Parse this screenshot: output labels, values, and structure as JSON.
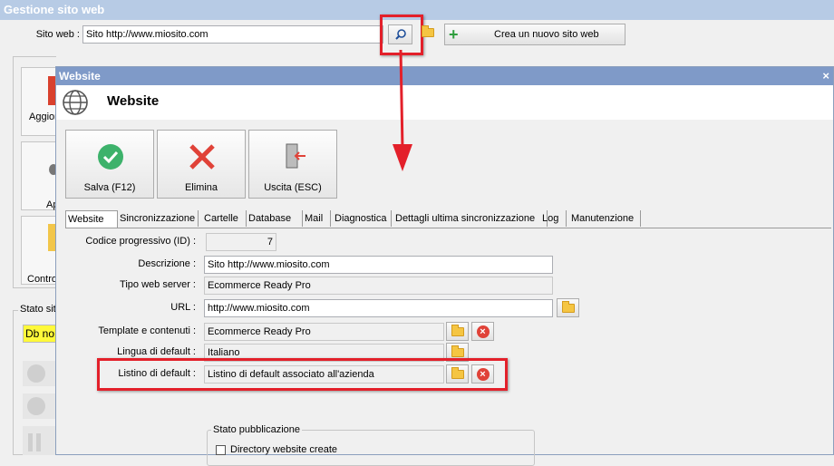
{
  "app_title": "Gestione sito web",
  "sitoweb": {
    "label": "Sito web :",
    "value": "Sito http://www.miosito.com",
    "new_site_label": "Crea un nuovo sito web"
  },
  "side": {
    "btn1": "Aggior",
    "btn2": "Ap",
    "btn3": "Contro",
    "stato": "Stato sit",
    "db": "Db no"
  },
  "dialog": {
    "title": "Website",
    "close": "×",
    "header": "Website",
    "buttons": {
      "save": "Salva (F12)",
      "delete": "Elimina",
      "exit": "Uscita (ESC)"
    },
    "tabs": [
      "Website",
      "Sincronizzazione",
      "Cartelle",
      "Database",
      "Mail",
      "Diagnostica",
      "Dettagli ultima sincronizzazione",
      "Log",
      "Manutenzione"
    ],
    "form": {
      "id_label": "Codice progressivo (ID) :",
      "id_value": "7",
      "desc_label": "Descrizione :",
      "desc_value": "Sito http://www.miosito.com",
      "server_label": "Tipo web server :",
      "server_value": "Ecommerce Ready Pro",
      "url_label": "URL :",
      "url_value": "http://www.miosito.com",
      "template_label": "Template e contenuti :",
      "template_value": "Ecommerce Ready Pro",
      "lang_label": "Lingua di default :",
      "lang_value": "Italiano",
      "listino_label": "Listino di default :",
      "listino_value": "Listino di default associato all'azienda"
    },
    "stato": {
      "title": "Stato pubblicazione",
      "checkbox": "Directory website create"
    }
  }
}
